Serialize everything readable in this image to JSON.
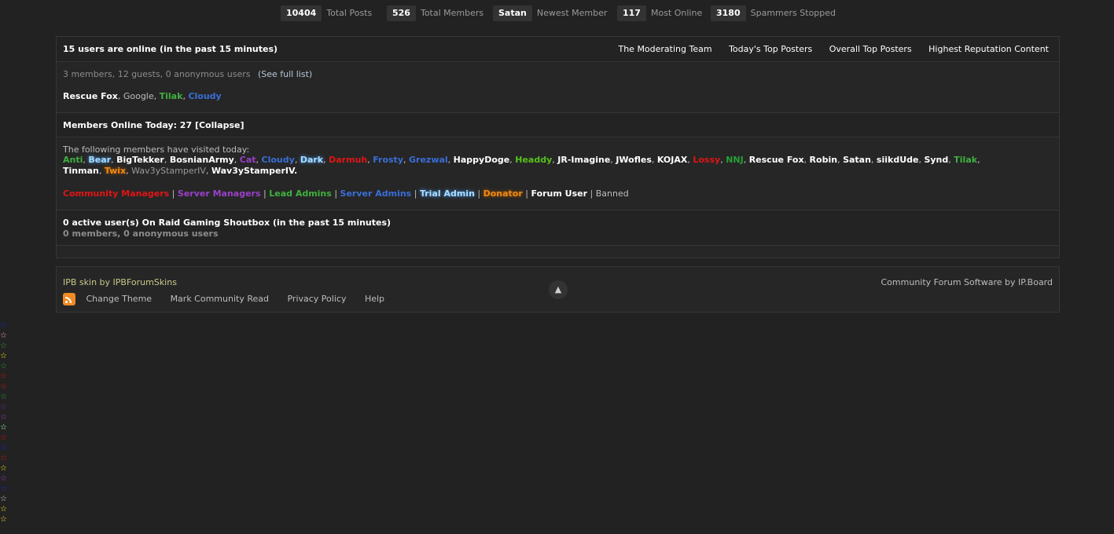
{
  "stats": [
    {
      "value": "10404",
      "label": "Total Posts"
    },
    {
      "value": "526",
      "label": "Total Members"
    },
    {
      "value": "Satan",
      "label": "Newest Member"
    },
    {
      "value": "117",
      "label": "Most Online"
    },
    {
      "value": "3180",
      "label": "Spammers Stopped"
    }
  ],
  "online": {
    "title": "15 users are online (in the past 15 minutes)",
    "links": [
      "The Moderating Team",
      "Today's Top Posters",
      "Overall Top Posters",
      "Highest Reputation Content"
    ],
    "summary": "3 members, 12 guests, 0 anonymous users",
    "see_full_list": "(See full list)",
    "users": [
      {
        "name": "Rescue Fox",
        "style": "name"
      },
      {
        "name": "Google",
        "style": "plain"
      },
      {
        "name": "Tilak",
        "style": "green"
      },
      {
        "name": "Cloudy",
        "style": "blue"
      }
    ]
  },
  "today": {
    "title": "Members Online Today: 27 [Collapse]",
    "intro": "The following members have visited today:",
    "members": [
      {
        "name": "Anti",
        "style": "green"
      },
      {
        "name": "Bear",
        "style": "cyan"
      },
      {
        "name": "BigTekker",
        "style": "name"
      },
      {
        "name": "BosnianArmy",
        "style": "name"
      },
      {
        "name": "Cat",
        "style": "purple"
      },
      {
        "name": "Cloudy",
        "style": "blue"
      },
      {
        "name": "Dark",
        "style": "cyan"
      },
      {
        "name": "Darmuh",
        "style": "red"
      },
      {
        "name": "Frosty",
        "style": "blue"
      },
      {
        "name": "Grezwal",
        "style": "blue"
      },
      {
        "name": "HappyDoge",
        "style": "name"
      },
      {
        "name": "Headdy",
        "style": "lime"
      },
      {
        "name": "JR-Imagine",
        "style": "name"
      },
      {
        "name": "JWofles",
        "style": "name"
      },
      {
        "name": "KOJAX",
        "style": "name"
      },
      {
        "name": "Lossy",
        "style": "red"
      },
      {
        "name": "NNJ",
        "style": "dark-green"
      },
      {
        "name": "Rescue Fox",
        "style": "name"
      },
      {
        "name": "Robin",
        "style": "name"
      },
      {
        "name": "Satan",
        "style": "name"
      },
      {
        "name": "siikdUde",
        "style": "name"
      },
      {
        "name": "Synd",
        "style": "name"
      },
      {
        "name": "Tilak",
        "style": "green"
      },
      {
        "name": "Tinman",
        "style": "name"
      },
      {
        "name": "Twix",
        "style": "orange"
      },
      {
        "name": "Wav3yStamperIV",
        "style": "grey-name"
      },
      {
        "name": "Wav3yStamperIV.",
        "style": "name"
      }
    ],
    "legend": [
      {
        "label": "Community Managers",
        "style": "red"
      },
      {
        "label": "Server Managers",
        "style": "purple"
      },
      {
        "label": "Lead Admins",
        "style": "green"
      },
      {
        "label": "Server Admins",
        "style": "blue"
      },
      {
        "label": "Trial Admin",
        "style": "cyan"
      },
      {
        "label": "Donator",
        "style": "orange"
      },
      {
        "label": "Forum User",
        "style": "name"
      },
      {
        "label": "Banned",
        "style": "plain"
      }
    ]
  },
  "shoutbox": {
    "title": "0 active user(s) On Raid Gaming Shoutbox (in the past 15 minutes)",
    "summary": "0 members, 0 anonymous users"
  },
  "footer": {
    "skin": "IPB skin by IPBForumSkins",
    "copyright": "Community Forum Software by IP.Board",
    "links": [
      "Change Theme",
      "Mark Community Read",
      "Privacy Policy",
      "Help"
    ],
    "to_top_icon": "arrow-up-icon",
    "rss_icon": "rss-icon"
  },
  "star_colors": [
    "#1a2ad8",
    "#f0a0c0",
    "#30a030",
    "#f0e020",
    "#30a030",
    "#e01515",
    "#e01515",
    "#30a030",
    "#6a2a9a",
    "#9a40c8",
    "#a0ffa0",
    "#e01515",
    "#1a2ad8",
    "#e01515",
    "#f0e020",
    "#9a40c8",
    "#1a2ad8",
    "#d0d0d0",
    "#f0e020",
    "#f0e020"
  ]
}
